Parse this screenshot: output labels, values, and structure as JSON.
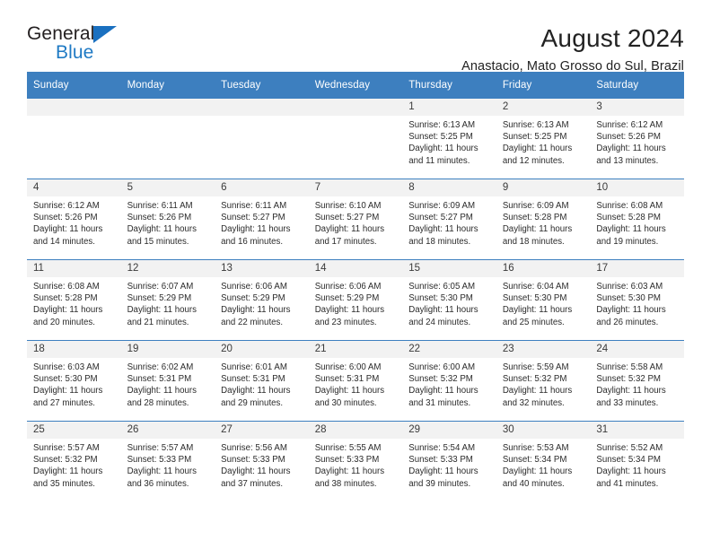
{
  "brand": {
    "name_top": "General",
    "name_bottom": "Blue",
    "triangle_color": "#1a70c0",
    "blue_text_color": "#1f7ac4"
  },
  "header": {
    "title": "August 2024",
    "location": "Anastacio, Mato Grosso do Sul, Brazil"
  },
  "theme": {
    "header_row_bg": "#3d7fbf",
    "daynum_bg": "#f2f2f2",
    "row_divider": "#3d7fbf",
    "text": "#2b2b2b"
  },
  "weekdays": [
    "Sunday",
    "Monday",
    "Tuesday",
    "Wednesday",
    "Thursday",
    "Friday",
    "Saturday"
  ],
  "weeks": [
    [
      {
        "day": "",
        "blank": true,
        "l1": "",
        "l2": "",
        "l3": "",
        "l4": ""
      },
      {
        "day": "",
        "blank": true,
        "l1": "",
        "l2": "",
        "l3": "",
        "l4": ""
      },
      {
        "day": "",
        "blank": true,
        "l1": "",
        "l2": "",
        "l3": "",
        "l4": ""
      },
      {
        "day": "",
        "blank": true,
        "l1": "",
        "l2": "",
        "l3": "",
        "l4": ""
      },
      {
        "day": "1",
        "blank": false,
        "l1": "Sunrise: 6:13 AM",
        "l2": "Sunset: 5:25 PM",
        "l3": "Daylight: 11 hours",
        "l4": "and 11 minutes."
      },
      {
        "day": "2",
        "blank": false,
        "l1": "Sunrise: 6:13 AM",
        "l2": "Sunset: 5:25 PM",
        "l3": "Daylight: 11 hours",
        "l4": "and 12 minutes."
      },
      {
        "day": "3",
        "blank": false,
        "l1": "Sunrise: 6:12 AM",
        "l2": "Sunset: 5:26 PM",
        "l3": "Daylight: 11 hours",
        "l4": "and 13 minutes."
      }
    ],
    [
      {
        "day": "4",
        "blank": false,
        "l1": "Sunrise: 6:12 AM",
        "l2": "Sunset: 5:26 PM",
        "l3": "Daylight: 11 hours",
        "l4": "and 14 minutes."
      },
      {
        "day": "5",
        "blank": false,
        "l1": "Sunrise: 6:11 AM",
        "l2": "Sunset: 5:26 PM",
        "l3": "Daylight: 11 hours",
        "l4": "and 15 minutes."
      },
      {
        "day": "6",
        "blank": false,
        "l1": "Sunrise: 6:11 AM",
        "l2": "Sunset: 5:27 PM",
        "l3": "Daylight: 11 hours",
        "l4": "and 16 minutes."
      },
      {
        "day": "7",
        "blank": false,
        "l1": "Sunrise: 6:10 AM",
        "l2": "Sunset: 5:27 PM",
        "l3": "Daylight: 11 hours",
        "l4": "and 17 minutes."
      },
      {
        "day": "8",
        "blank": false,
        "l1": "Sunrise: 6:09 AM",
        "l2": "Sunset: 5:27 PM",
        "l3": "Daylight: 11 hours",
        "l4": "and 18 minutes."
      },
      {
        "day": "9",
        "blank": false,
        "l1": "Sunrise: 6:09 AM",
        "l2": "Sunset: 5:28 PM",
        "l3": "Daylight: 11 hours",
        "l4": "and 18 minutes."
      },
      {
        "day": "10",
        "blank": false,
        "l1": "Sunrise: 6:08 AM",
        "l2": "Sunset: 5:28 PM",
        "l3": "Daylight: 11 hours",
        "l4": "and 19 minutes."
      }
    ],
    [
      {
        "day": "11",
        "blank": false,
        "l1": "Sunrise: 6:08 AM",
        "l2": "Sunset: 5:28 PM",
        "l3": "Daylight: 11 hours",
        "l4": "and 20 minutes."
      },
      {
        "day": "12",
        "blank": false,
        "l1": "Sunrise: 6:07 AM",
        "l2": "Sunset: 5:29 PM",
        "l3": "Daylight: 11 hours",
        "l4": "and 21 minutes."
      },
      {
        "day": "13",
        "blank": false,
        "l1": "Sunrise: 6:06 AM",
        "l2": "Sunset: 5:29 PM",
        "l3": "Daylight: 11 hours",
        "l4": "and 22 minutes."
      },
      {
        "day": "14",
        "blank": false,
        "l1": "Sunrise: 6:06 AM",
        "l2": "Sunset: 5:29 PM",
        "l3": "Daylight: 11 hours",
        "l4": "and 23 minutes."
      },
      {
        "day": "15",
        "blank": false,
        "l1": "Sunrise: 6:05 AM",
        "l2": "Sunset: 5:30 PM",
        "l3": "Daylight: 11 hours",
        "l4": "and 24 minutes."
      },
      {
        "day": "16",
        "blank": false,
        "l1": "Sunrise: 6:04 AM",
        "l2": "Sunset: 5:30 PM",
        "l3": "Daylight: 11 hours",
        "l4": "and 25 minutes."
      },
      {
        "day": "17",
        "blank": false,
        "l1": "Sunrise: 6:03 AM",
        "l2": "Sunset: 5:30 PM",
        "l3": "Daylight: 11 hours",
        "l4": "and 26 minutes."
      }
    ],
    [
      {
        "day": "18",
        "blank": false,
        "l1": "Sunrise: 6:03 AM",
        "l2": "Sunset: 5:30 PM",
        "l3": "Daylight: 11 hours",
        "l4": "and 27 minutes."
      },
      {
        "day": "19",
        "blank": false,
        "l1": "Sunrise: 6:02 AM",
        "l2": "Sunset: 5:31 PM",
        "l3": "Daylight: 11 hours",
        "l4": "and 28 minutes."
      },
      {
        "day": "20",
        "blank": false,
        "l1": "Sunrise: 6:01 AM",
        "l2": "Sunset: 5:31 PM",
        "l3": "Daylight: 11 hours",
        "l4": "and 29 minutes."
      },
      {
        "day": "21",
        "blank": false,
        "l1": "Sunrise: 6:00 AM",
        "l2": "Sunset: 5:31 PM",
        "l3": "Daylight: 11 hours",
        "l4": "and 30 minutes."
      },
      {
        "day": "22",
        "blank": false,
        "l1": "Sunrise: 6:00 AM",
        "l2": "Sunset: 5:32 PM",
        "l3": "Daylight: 11 hours",
        "l4": "and 31 minutes."
      },
      {
        "day": "23",
        "blank": false,
        "l1": "Sunrise: 5:59 AM",
        "l2": "Sunset: 5:32 PM",
        "l3": "Daylight: 11 hours",
        "l4": "and 32 minutes."
      },
      {
        "day": "24",
        "blank": false,
        "l1": "Sunrise: 5:58 AM",
        "l2": "Sunset: 5:32 PM",
        "l3": "Daylight: 11 hours",
        "l4": "and 33 minutes."
      }
    ],
    [
      {
        "day": "25",
        "blank": false,
        "l1": "Sunrise: 5:57 AM",
        "l2": "Sunset: 5:32 PM",
        "l3": "Daylight: 11 hours",
        "l4": "and 35 minutes."
      },
      {
        "day": "26",
        "blank": false,
        "l1": "Sunrise: 5:57 AM",
        "l2": "Sunset: 5:33 PM",
        "l3": "Daylight: 11 hours",
        "l4": "and 36 minutes."
      },
      {
        "day": "27",
        "blank": false,
        "l1": "Sunrise: 5:56 AM",
        "l2": "Sunset: 5:33 PM",
        "l3": "Daylight: 11 hours",
        "l4": "and 37 minutes."
      },
      {
        "day": "28",
        "blank": false,
        "l1": "Sunrise: 5:55 AM",
        "l2": "Sunset: 5:33 PM",
        "l3": "Daylight: 11 hours",
        "l4": "and 38 minutes."
      },
      {
        "day": "29",
        "blank": false,
        "l1": "Sunrise: 5:54 AM",
        "l2": "Sunset: 5:33 PM",
        "l3": "Daylight: 11 hours",
        "l4": "and 39 minutes."
      },
      {
        "day": "30",
        "blank": false,
        "l1": "Sunrise: 5:53 AM",
        "l2": "Sunset: 5:34 PM",
        "l3": "Daylight: 11 hours",
        "l4": "and 40 minutes."
      },
      {
        "day": "31",
        "blank": false,
        "l1": "Sunrise: 5:52 AM",
        "l2": "Sunset: 5:34 PM",
        "l3": "Daylight: 11 hours",
        "l4": "and 41 minutes."
      }
    ]
  ]
}
